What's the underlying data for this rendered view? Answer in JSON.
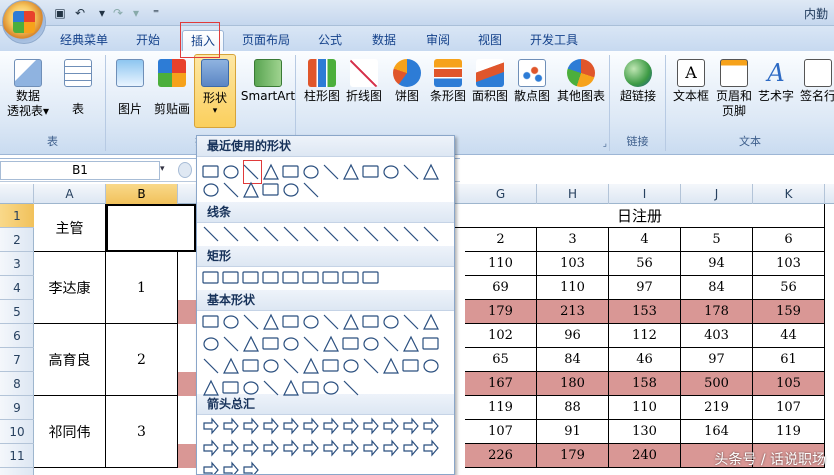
{
  "window": {
    "title": "内勤"
  },
  "tabs": [
    {
      "label": "经典菜单"
    },
    {
      "label": "开始"
    },
    {
      "label": "插入"
    },
    {
      "label": "页面布局"
    },
    {
      "label": "公式"
    },
    {
      "label": "数据"
    },
    {
      "label": "审阅"
    },
    {
      "label": "视图"
    },
    {
      "label": "开发工具"
    }
  ],
  "active_tab": "插入",
  "ribbon": {
    "groups": [
      {
        "label": "表",
        "buttons": [
          "数据透视表▾",
          "表"
        ]
      },
      {
        "label": "插",
        "buttons": [
          "图片",
          "剪贴画",
          "形状",
          "SmartArt"
        ]
      },
      {
        "label": "",
        "buttons": [
          "柱形图",
          "折线图",
          "饼图",
          "条形图",
          "面积图",
          "散点图",
          "其他图表"
        ]
      },
      {
        "label": "链接",
        "buttons": [
          "超链接"
        ]
      },
      {
        "label": "文本",
        "buttons": [
          "文本框",
          "页眉和页脚",
          "艺术字",
          "签名行"
        ]
      }
    ],
    "pivot_line1": "数据",
    "pivot_line2": "透视表▾",
    "header_line1": "页眉和",
    "header_line2": "页脚"
  },
  "formula_bar": {
    "name_box": "B1"
  },
  "columns": [
    "A",
    "B",
    "G",
    "H",
    "I",
    "J",
    "K"
  ],
  "rows": [
    "1",
    "2",
    "3",
    "4",
    "5",
    "6",
    "7",
    "8",
    "9",
    "10",
    "11"
  ],
  "sheet": {
    "a1": "主管",
    "title": "日注册",
    "names": [
      "李达康",
      "高育良",
      "祁同伟"
    ],
    "nums": [
      "1",
      "2",
      "3"
    ],
    "header_days": [
      "2",
      "3",
      "4",
      "5",
      "6"
    ],
    "data": [
      [
        "110",
        "103",
        "56",
        "94",
        "103"
      ],
      [
        "69",
        "110",
        "97",
        "84",
        "56"
      ],
      [
        "179",
        "213",
        "153",
        "178",
        "159"
      ],
      [
        "102",
        "96",
        "112",
        "403",
        "44"
      ],
      [
        "65",
        "84",
        "46",
        "97",
        "61"
      ],
      [
        "167",
        "180",
        "158",
        "500",
        "105"
      ],
      [
        "119",
        "88",
        "110",
        "219",
        "107"
      ],
      [
        "107",
        "91",
        "130",
        "164",
        "119"
      ],
      [
        "226",
        "179",
        "240",
        "",
        ""
      ]
    ]
  },
  "shapes_menu": {
    "sections": [
      "最近使用的形状",
      "线条",
      "矩形",
      "基本形状",
      "箭头总汇"
    ]
  },
  "watermark": "头条号 / 话说职场"
}
